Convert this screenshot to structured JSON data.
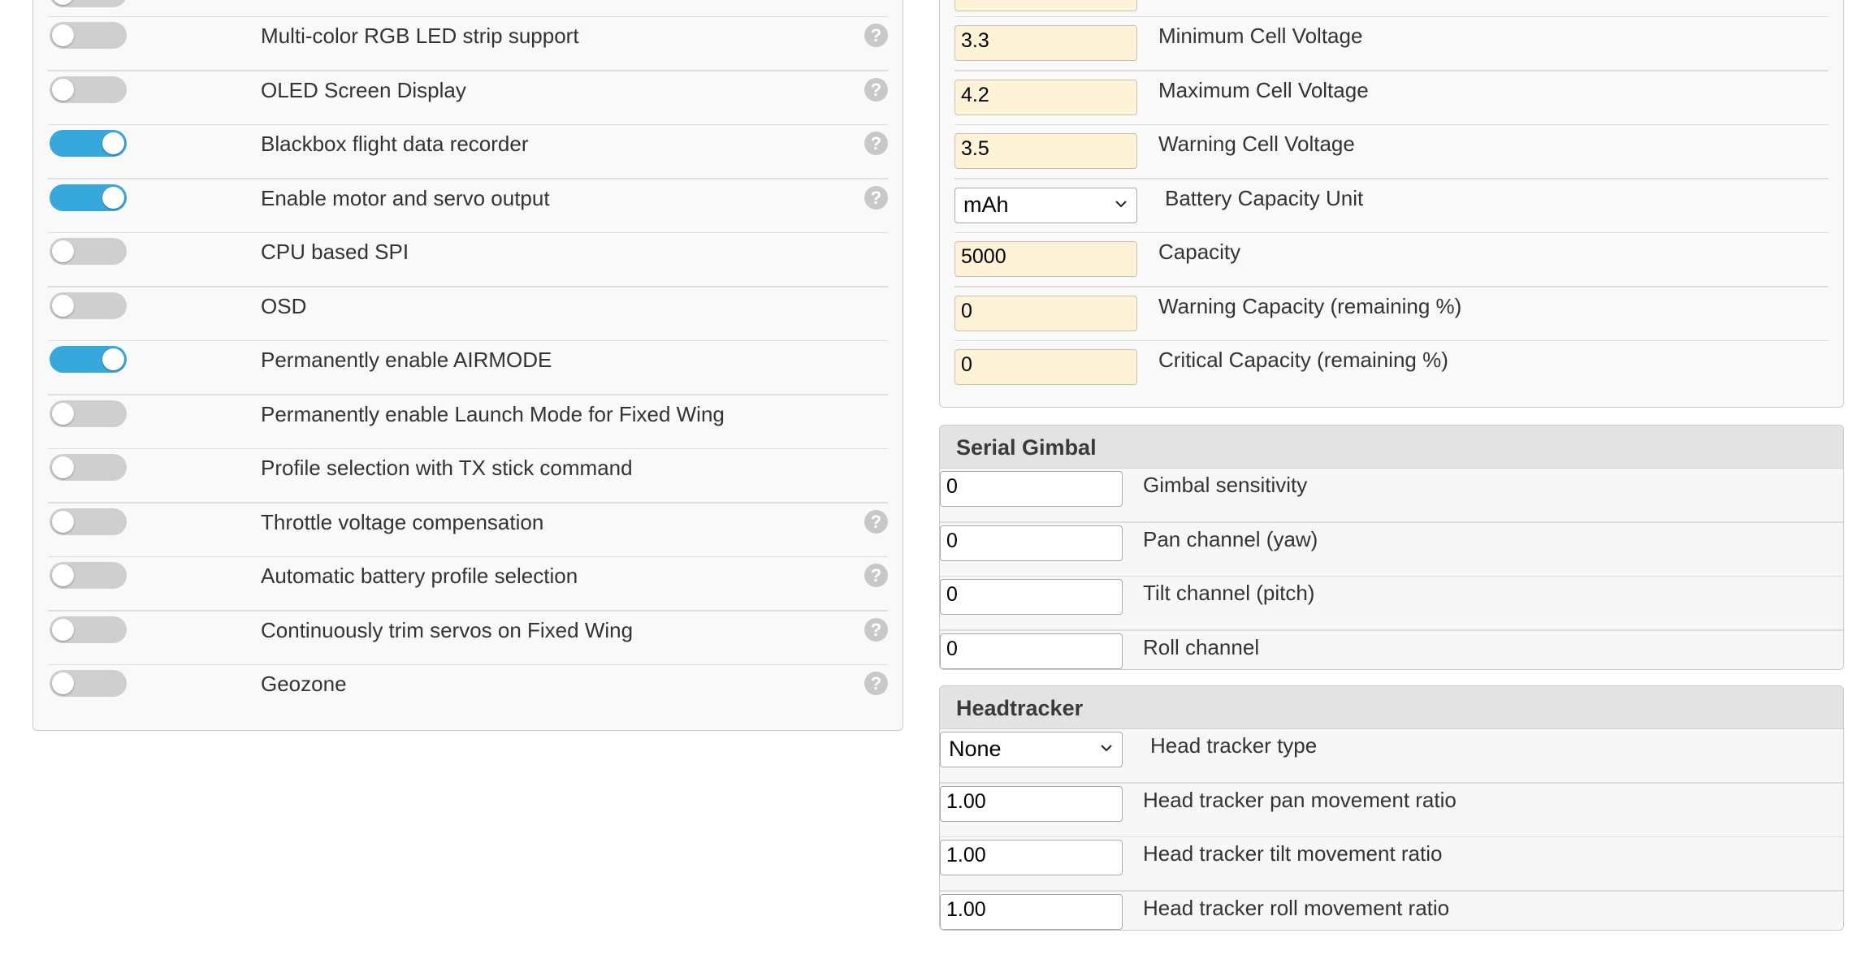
{
  "features": {
    "items": [
      {
        "label": "Multi-color RGB LED strip support",
        "enabled": false,
        "help": true
      },
      {
        "label": "OLED Screen Display",
        "enabled": false,
        "help": true
      },
      {
        "label": "Blackbox flight data recorder",
        "enabled": true,
        "help": true
      },
      {
        "label": "Enable motor and servo output",
        "enabled": true,
        "help": true
      },
      {
        "label": "CPU based SPI",
        "enabled": false,
        "help": false
      },
      {
        "label": "OSD",
        "enabled": false,
        "help": false
      },
      {
        "label": "Permanently enable AIRMODE",
        "enabled": true,
        "help": false
      },
      {
        "label": "Permanently enable Launch Mode for Fixed Wing",
        "enabled": false,
        "help": false
      },
      {
        "label": "Profile selection with TX stick command",
        "enabled": false,
        "help": false
      },
      {
        "label": "Throttle voltage compensation",
        "enabled": false,
        "help": true
      },
      {
        "label": "Automatic battery profile selection",
        "enabled": false,
        "help": true
      },
      {
        "label": "Continuously trim servos on Fixed Wing",
        "enabled": false,
        "help": true
      },
      {
        "label": "Geozone",
        "enabled": false,
        "help": true
      }
    ],
    "help_glyph": "?"
  },
  "battery": {
    "rows": [
      {
        "type": "input",
        "value": "3.3",
        "label": "Minimum Cell Voltage"
      },
      {
        "type": "input",
        "value": "4.2",
        "label": "Maximum Cell Voltage"
      },
      {
        "type": "input",
        "value": "3.5",
        "label": "Warning Cell Voltage"
      },
      {
        "type": "select",
        "value": "mAh",
        "label": "Battery Capacity Unit"
      },
      {
        "type": "input",
        "value": "5000",
        "label": "Capacity"
      },
      {
        "type": "input",
        "value": "0",
        "label": "Warning Capacity (remaining %)"
      },
      {
        "type": "input",
        "value": "0",
        "label": "Critical Capacity (remaining %)"
      }
    ]
  },
  "gimbal": {
    "title": "Serial Gimbal",
    "rows": [
      {
        "type": "input",
        "value": "0",
        "label": "Gimbal sensitivity"
      },
      {
        "type": "input",
        "value": "0",
        "label": "Pan channel (yaw)"
      },
      {
        "type": "input",
        "value": "0",
        "label": "Tilt channel (pitch)"
      },
      {
        "type": "input",
        "value": "0",
        "label": "Roll channel"
      }
    ]
  },
  "headtracker": {
    "title": "Headtracker",
    "rows": [
      {
        "type": "select",
        "value": "None",
        "label": "Head tracker type"
      },
      {
        "type": "input",
        "value": "1.00",
        "label": "Head tracker pan movement ratio"
      },
      {
        "type": "input",
        "value": "1.00",
        "label": "Head tracker tilt movement ratio"
      },
      {
        "type": "input",
        "value": "1.00",
        "label": "Head tracker roll movement ratio"
      }
    ]
  },
  "colors": {
    "toggle_on": "#37a8db",
    "toggle_off": "#cfcfcf",
    "input_highlight": "#fef3d6",
    "help_icon": "#c8c8c8"
  }
}
